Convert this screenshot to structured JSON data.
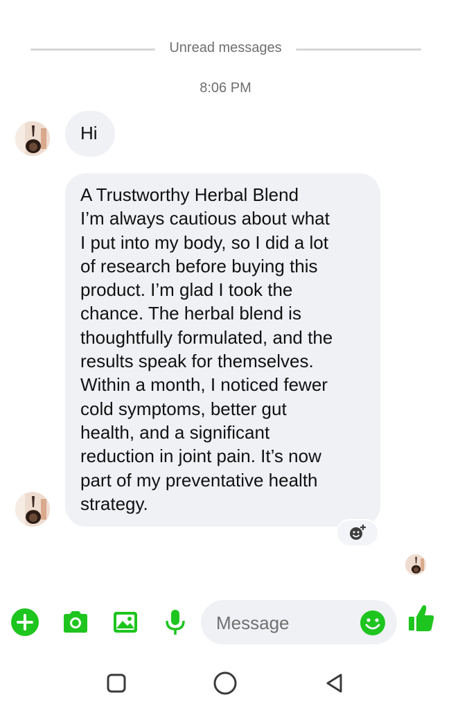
{
  "divider": {
    "label": "Unread messages"
  },
  "timestamp": "8:06 PM",
  "messages": [
    {
      "text": "Hi"
    },
    {
      "text": "A Trustworthy Herbal Blend\nI’m always cautious about what\nI put into my body, so I did a lot\nof research before buying this\nproduct. I’m glad I took the\nchance. The herbal blend is\nthoughtfully formulated, and the\nresults speak for themselves.\nWithin a month, I noticed fewer\ncold symptoms, better gut\nhealth, and a significant\nreduction in joint pain. It’s now\npart of my preventative health\nstrategy."
    }
  ],
  "composer": {
    "placeholder": "Message",
    "icons": [
      "plus-icon",
      "camera-icon",
      "gallery-icon",
      "microphone-icon",
      "emoji-icon",
      "thumbs-up-icon"
    ]
  },
  "reaction": {
    "icon": "add-reaction-icon"
  },
  "navbar": {
    "icons": [
      "recents-icon",
      "home-icon",
      "back-icon"
    ]
  },
  "colors": {
    "accent": "#1ec51e",
    "bubble": "#f0f1f5",
    "muted_text": "#6f6f6f",
    "divider": "#d6d6d6"
  }
}
